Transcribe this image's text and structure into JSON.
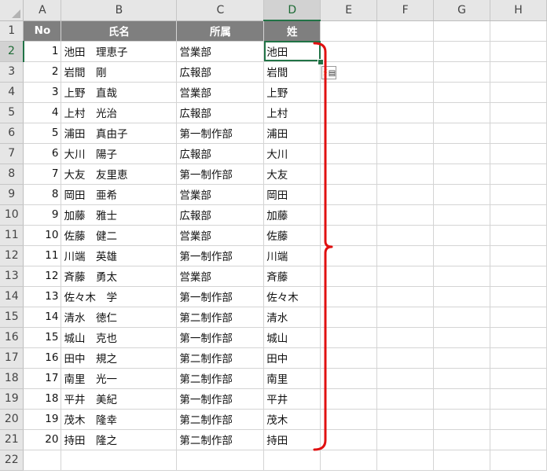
{
  "columns": [
    "A",
    "B",
    "C",
    "D",
    "E",
    "F",
    "G",
    "H"
  ],
  "header": {
    "no": "No",
    "name": "氏名",
    "dept": "所属",
    "surname": "姓"
  },
  "rows": [
    {
      "num": "2",
      "no": "1",
      "name": "池田　理恵子",
      "dept": "営業部",
      "surname": "池田"
    },
    {
      "num": "3",
      "no": "2",
      "name": "岩間　剛",
      "dept": "広報部",
      "surname": "岩間"
    },
    {
      "num": "4",
      "no": "3",
      "name": "上野　直哉",
      "dept": "営業部",
      "surname": "上野"
    },
    {
      "num": "5",
      "no": "4",
      "name": "上村　光治",
      "dept": "広報部",
      "surname": "上村"
    },
    {
      "num": "6",
      "no": "5",
      "name": "浦田　真由子",
      "dept": "第一制作部",
      "surname": "浦田"
    },
    {
      "num": "7",
      "no": "6",
      "name": "大川　陽子",
      "dept": "広報部",
      "surname": "大川"
    },
    {
      "num": "8",
      "no": "7",
      "name": "大友　友里恵",
      "dept": "第一制作部",
      "surname": "大友"
    },
    {
      "num": "9",
      "no": "8",
      "name": "岡田　亜希",
      "dept": "営業部",
      "surname": "岡田"
    },
    {
      "num": "10",
      "no": "9",
      "name": "加藤　雅士",
      "dept": "広報部",
      "surname": "加藤"
    },
    {
      "num": "11",
      "no": "10",
      "name": "佐藤　健二",
      "dept": "営業部",
      "surname": "佐藤"
    },
    {
      "num": "12",
      "no": "11",
      "name": "川端　英雄",
      "dept": "第一制作部",
      "surname": "川端"
    },
    {
      "num": "13",
      "no": "12",
      "name": "斉藤　勇太",
      "dept": "営業部",
      "surname": "斉藤"
    },
    {
      "num": "14",
      "no": "13",
      "name": "佐々木　学",
      "dept": "第一制作部",
      "surname": "佐々木"
    },
    {
      "num": "15",
      "no": "14",
      "name": "清水　徳仁",
      "dept": "第二制作部",
      "surname": "清水"
    },
    {
      "num": "16",
      "no": "15",
      "name": "城山　克也",
      "dept": "第一制作部",
      "surname": "城山"
    },
    {
      "num": "17",
      "no": "16",
      "name": "田中　規之",
      "dept": "第二制作部",
      "surname": "田中"
    },
    {
      "num": "18",
      "no": "17",
      "name": "南里　光一",
      "dept": "第二制作部",
      "surname": "南里"
    },
    {
      "num": "19",
      "no": "18",
      "name": "平井　美紀",
      "dept": "第一制作部",
      "surname": "平井"
    },
    {
      "num": "20",
      "no": "19",
      "name": "茂木　隆幸",
      "dept": "第二制作部",
      "surname": "茂木"
    },
    {
      "num": "21",
      "no": "20",
      "name": "持田　隆之",
      "dept": "第二制作部",
      "surname": "持田"
    }
  ],
  "header_row_num": "1",
  "empty_rows": [
    "22"
  ],
  "flash_fill_icon": "flash-fill-icon",
  "colors": {
    "accent": "#217346",
    "header_fill": "#7f7f7f",
    "brace": "#e01010"
  }
}
